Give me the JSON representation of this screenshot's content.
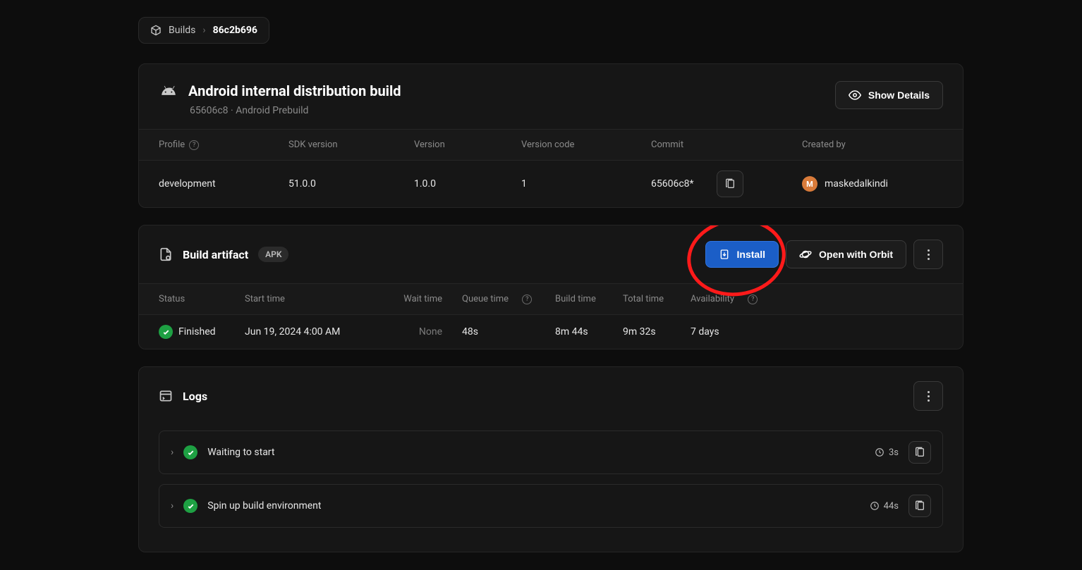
{
  "breadcrumb": {
    "root": "Builds",
    "current": "86c2b696"
  },
  "header": {
    "title": "Android internal distribution build",
    "subtitle": "65606c8 · Android Prebuild",
    "show_details_label": "Show Details"
  },
  "info": {
    "headers": {
      "profile": "Profile",
      "sdk": "SDK version",
      "version": "Version",
      "vcode": "Version code",
      "commit": "Commit",
      "created": "Created by"
    },
    "row": {
      "profile": "development",
      "sdk": "51.0.0",
      "version": "1.0.0",
      "vcode": "1",
      "commit": "65606c8*",
      "created_initial": "M",
      "created_name": "maskedalkindi"
    }
  },
  "artifact": {
    "title": "Build artifact",
    "badge": "APK",
    "install_label": "Install",
    "orbit_label": "Open with Orbit"
  },
  "stats": {
    "headers": {
      "status": "Status",
      "start": "Start time",
      "wait": "Wait time",
      "queue": "Queue time",
      "build": "Build time",
      "total": "Total time",
      "avail": "Availability"
    },
    "row": {
      "status": "Finished",
      "start": "Jun 19, 2024 4:00 AM",
      "wait": "None",
      "queue": "48s",
      "build": "8m 44s",
      "total": "9m 32s",
      "avail": "7 days"
    }
  },
  "logs": {
    "title": "Logs",
    "steps": [
      {
        "label": "Waiting to start",
        "time": "3s"
      },
      {
        "label": "Spin up build environment",
        "time": "44s"
      }
    ]
  }
}
